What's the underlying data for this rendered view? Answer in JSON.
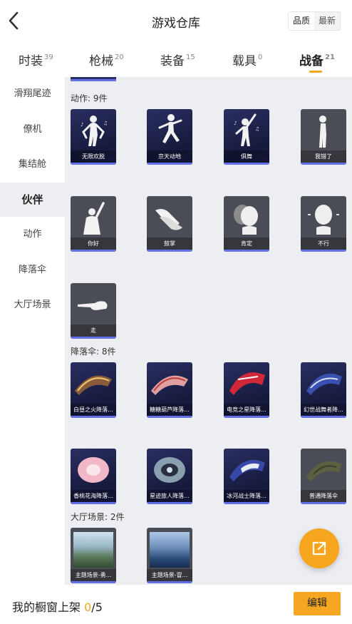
{
  "header": {
    "title": "游戏仓库",
    "sort_quality": "品质",
    "sort_newest": "最新",
    "back_icon": "chevron-left-icon"
  },
  "tabs": [
    {
      "label": "时装",
      "count": "39"
    },
    {
      "label": "枪械",
      "count": "20"
    },
    {
      "label": "装备",
      "count": "15"
    },
    {
      "label": "载具",
      "count": "0"
    },
    {
      "label": "战备",
      "count": "21",
      "active": true
    }
  ],
  "sidebar": [
    {
      "label": "滑翔尾迹"
    },
    {
      "label": "僚机"
    },
    {
      "label": "集结舱"
    },
    {
      "label": "伙伴",
      "active": true
    },
    {
      "label": "动作"
    },
    {
      "label": "降落伞"
    },
    {
      "label": "大厅场景"
    }
  ],
  "sections": {
    "emotes": {
      "label": "动作: 9件"
    },
    "parachutes": {
      "label": "降落伞: 8件"
    },
    "lobby": {
      "label": "大厅场景: 2件"
    }
  },
  "emotes": [
    "无限欢脱",
    "京天动地",
    "俱舞",
    "我错了",
    "你好",
    "鼓掌",
    "肯定",
    "不行",
    "走"
  ],
  "parachutes": [
    "白昼之火降落...",
    "糖糖葫芦降落...",
    "电竞之星降落...",
    "幻世战舞者降...",
    "香桃花海降落...",
    "星迹旅人降落...",
    "冰河战士降落...",
    "普通降落伞"
  ],
  "lobby": [
    "主题场景-勇...",
    "主题场景-冒..."
  ],
  "footer": {
    "shelf_label": "我的橱窗上架",
    "shelf_count": "0",
    "shelf_total": "/5",
    "edit_label": "编辑"
  },
  "colors": {
    "accent": "#f5a623",
    "rarity_bar": "#6470e8",
    "card_dark": "#1c2050",
    "card_gray": "#4a4d55"
  },
  "share_icon": "share-external-icon"
}
